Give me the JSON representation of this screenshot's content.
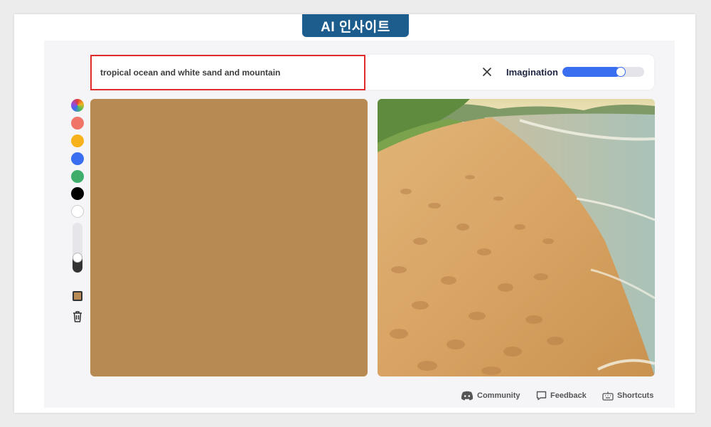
{
  "badge": {
    "title": "AI 인사이트"
  },
  "prompt": {
    "value": "tropical ocean and white sand and mountain"
  },
  "imagination": {
    "label": "Imagination",
    "value": 0.65
  },
  "palette": {
    "swatches": [
      "#f07468",
      "#f7b21b",
      "#3a6ef0",
      "#3fae6a",
      "#000000",
      "#ffffff"
    ],
    "current_color": "#b88a53"
  },
  "brush": {
    "size": 0.3
  },
  "canvas": {
    "fill_color": "#b88a53"
  },
  "footer": {
    "community": "Community",
    "feedback": "Feedback",
    "shortcuts": "Shortcuts"
  }
}
